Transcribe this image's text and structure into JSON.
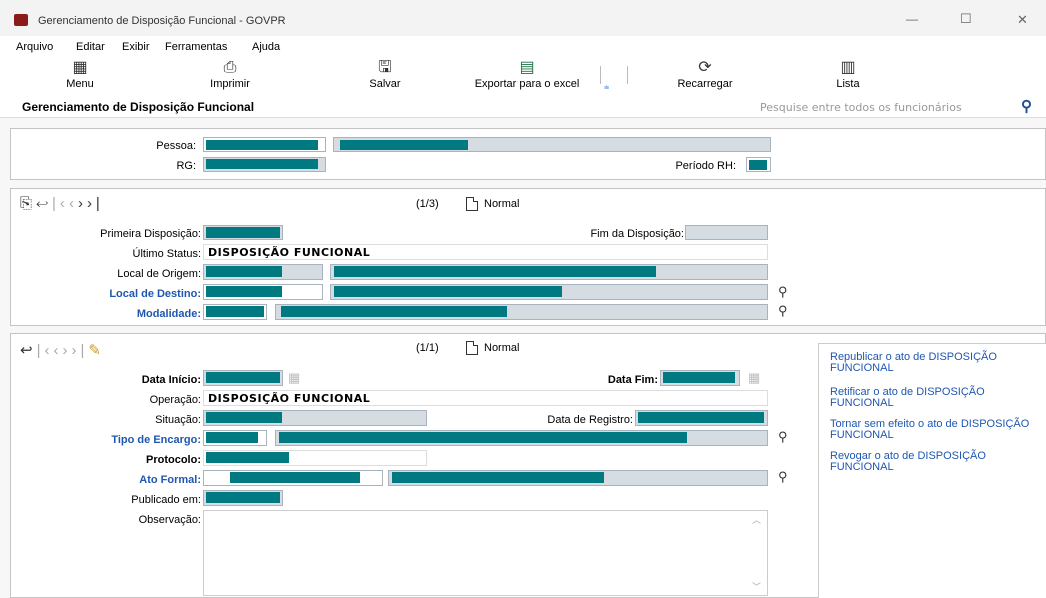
{
  "window": {
    "title": "Gerenciamento de Disposição Funcional - GOVPR",
    "min": "—",
    "max": "☐",
    "close": "✕"
  },
  "menubar": [
    "Arquivo",
    "Editar",
    "Exibir",
    "Ferramentas",
    "Ajuda"
  ],
  "toolbar": {
    "menu": "Menu",
    "print": "Imprimir",
    "save": "Salvar",
    "export": "Exportar para o excel",
    "reload": "Recarregar",
    "list": "Lista"
  },
  "header": {
    "title": "Gerenciamento de Disposição Funcional",
    "search_placeholder": "Pesquise entre todos os funcionários"
  },
  "person": {
    "pessoa_label": "Pessoa:",
    "rg_label": "RG:",
    "periodo_label": "Período RH:"
  },
  "disposicao": {
    "counter": "(1/3)",
    "mode": "Normal",
    "primeira_label": "Primeira Disposição:",
    "fim_label": "Fim da Disposição:",
    "ultimo_status_label": "Último Status:",
    "ultimo_status_value": "DISPOSIÇÃO FUNCIONAL",
    "local_origem_label": "Local de Origem:",
    "local_destino_label": "Local de Destino:",
    "modalidade_label": "Modalidade:"
  },
  "ato": {
    "counter": "(1/1)",
    "mode": "Normal",
    "data_inicio_label": "Data Início:",
    "data_fim_label": "Data Fim:",
    "operacao_label": "Operação:",
    "operacao_value": "DISPOSIÇÃO FUNCIONAL",
    "situacao_label": "Situação:",
    "data_registro_label": "Data de Registro:",
    "tipo_encargo_label": "Tipo de Encargo:",
    "protocolo_label": "Protocolo:",
    "ato_formal_label": "Ato Formal:",
    "publicado_label": "Publicado em:",
    "observacao_label": "Observação:"
  },
  "actions": [
    "Republicar o ato de DISPOSIÇÃO FUNCIONAL",
    "Retificar o ato de DISPOSIÇÃO FUNCIONAL",
    "Tornar sem efeito o ato de DISPOSIÇÃO FUNCIONAL",
    "Revogar o ato de DISPOSIÇÃO FUNCIONAL"
  ]
}
